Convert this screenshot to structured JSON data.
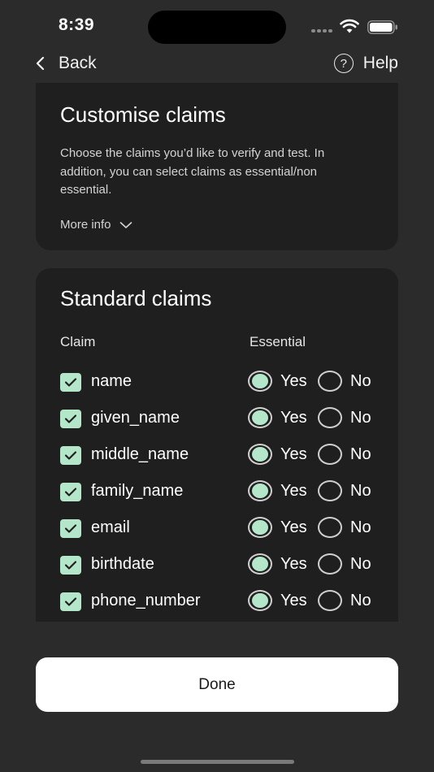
{
  "status_bar": {
    "time": "8:39"
  },
  "nav": {
    "back_label": "Back",
    "help_label": "Help",
    "help_glyph": "?"
  },
  "intro": {
    "title": "Customise claims",
    "description": "Choose the claims you’d like to verify and test. In addition, you can select claims as essential/non essential.",
    "more_info_label": "More info"
  },
  "claims": {
    "title": "Standard claims",
    "column_claim": "Claim",
    "column_essential": "Essential",
    "yes_label": "Yes",
    "no_label": "No",
    "rows": [
      {
        "name": "name",
        "checked": true,
        "essential": "Yes"
      },
      {
        "name": "given_name",
        "checked": true,
        "essential": "Yes"
      },
      {
        "name": "middle_name",
        "checked": true,
        "essential": "Yes"
      },
      {
        "name": "family_name",
        "checked": true,
        "essential": "Yes"
      },
      {
        "name": "email",
        "checked": true,
        "essential": "Yes"
      },
      {
        "name": "birthdate",
        "checked": true,
        "essential": "Yes"
      },
      {
        "name": "phone_number",
        "checked": true,
        "essential": "Yes"
      }
    ]
  },
  "done_label": "Done",
  "colors": {
    "background": "#2b2b2b",
    "card": "#1f1f1f",
    "accent": "#b4e7c9",
    "button": "#ffffff"
  },
  "icons": {
    "back": "chevron-left-icon",
    "help": "question-circle-icon",
    "more_info": "chevron-down-icon",
    "check": "check-icon",
    "wifi": "wifi-icon",
    "battery": "battery-icon"
  }
}
